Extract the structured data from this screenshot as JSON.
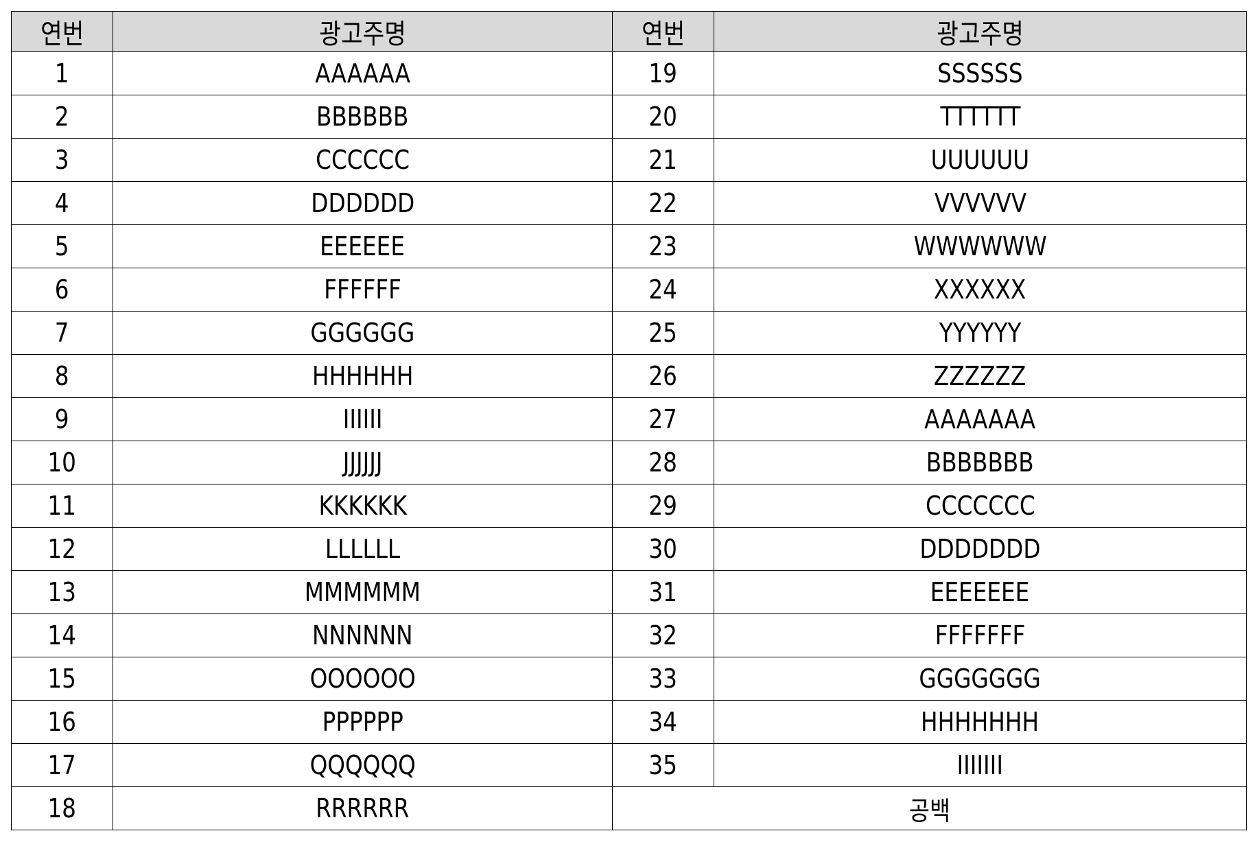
{
  "table": {
    "headers": [
      "연번",
      "광고주명",
      "연번",
      "광고주명"
    ],
    "left_rows": [
      {
        "no": "1",
        "name": "AAAAAA"
      },
      {
        "no": "2",
        "name": "BBBBBB"
      },
      {
        "no": "3",
        "name": "CCCCCC"
      },
      {
        "no": "4",
        "name": "DDDDDD"
      },
      {
        "no": "5",
        "name": "EEEEEE"
      },
      {
        "no": "6",
        "name": "FFFFFF"
      },
      {
        "no": "7",
        "name": "GGGGGG"
      },
      {
        "no": "8",
        "name": "HHHHHH"
      },
      {
        "no": "9",
        "name": "IIIIII"
      },
      {
        "no": "10",
        "name": "JJJJJJ"
      },
      {
        "no": "11",
        "name": "KKKKKK"
      },
      {
        "no": "12",
        "name": "LLLLLL"
      },
      {
        "no": "13",
        "name": "MMMMMM"
      },
      {
        "no": "14",
        "name": "NNNNNN"
      },
      {
        "no": "15",
        "name": "OOOOOO"
      },
      {
        "no": "16",
        "name": "PPPPPP"
      },
      {
        "no": "17",
        "name": "QQQQQQ"
      },
      {
        "no": "18",
        "name": "RRRRRR"
      }
    ],
    "right_rows": [
      {
        "no": "19",
        "name": "SSSSSS"
      },
      {
        "no": "20",
        "name": "TTTTTT"
      },
      {
        "no": "21",
        "name": "UUUUUU"
      },
      {
        "no": "22",
        "name": "VVVVVV"
      },
      {
        "no": "23",
        "name": "WWWWWW"
      },
      {
        "no": "24",
        "name": "XXXXXX"
      },
      {
        "no": "25",
        "name": "YYYYYY"
      },
      {
        "no": "26",
        "name": "ZZZZZZ"
      },
      {
        "no": "27",
        "name": "AAAAAAA"
      },
      {
        "no": "28",
        "name": "BBBBBBB"
      },
      {
        "no": "29",
        "name": "CCCCCCC"
      },
      {
        "no": "30",
        "name": "DDDDDDD"
      },
      {
        "no": "31",
        "name": "EEEEEEE"
      },
      {
        "no": "32",
        "name": "FFFFFFF"
      },
      {
        "no": "33",
        "name": "GGGGGGG"
      },
      {
        "no": "34",
        "name": "HHHHHHH"
      },
      {
        "no": "35",
        "name": "IIIIIII"
      }
    ],
    "blank_label": "공백",
    "header_bg": "#d9d9d9",
    "border_color": "#000000"
  }
}
